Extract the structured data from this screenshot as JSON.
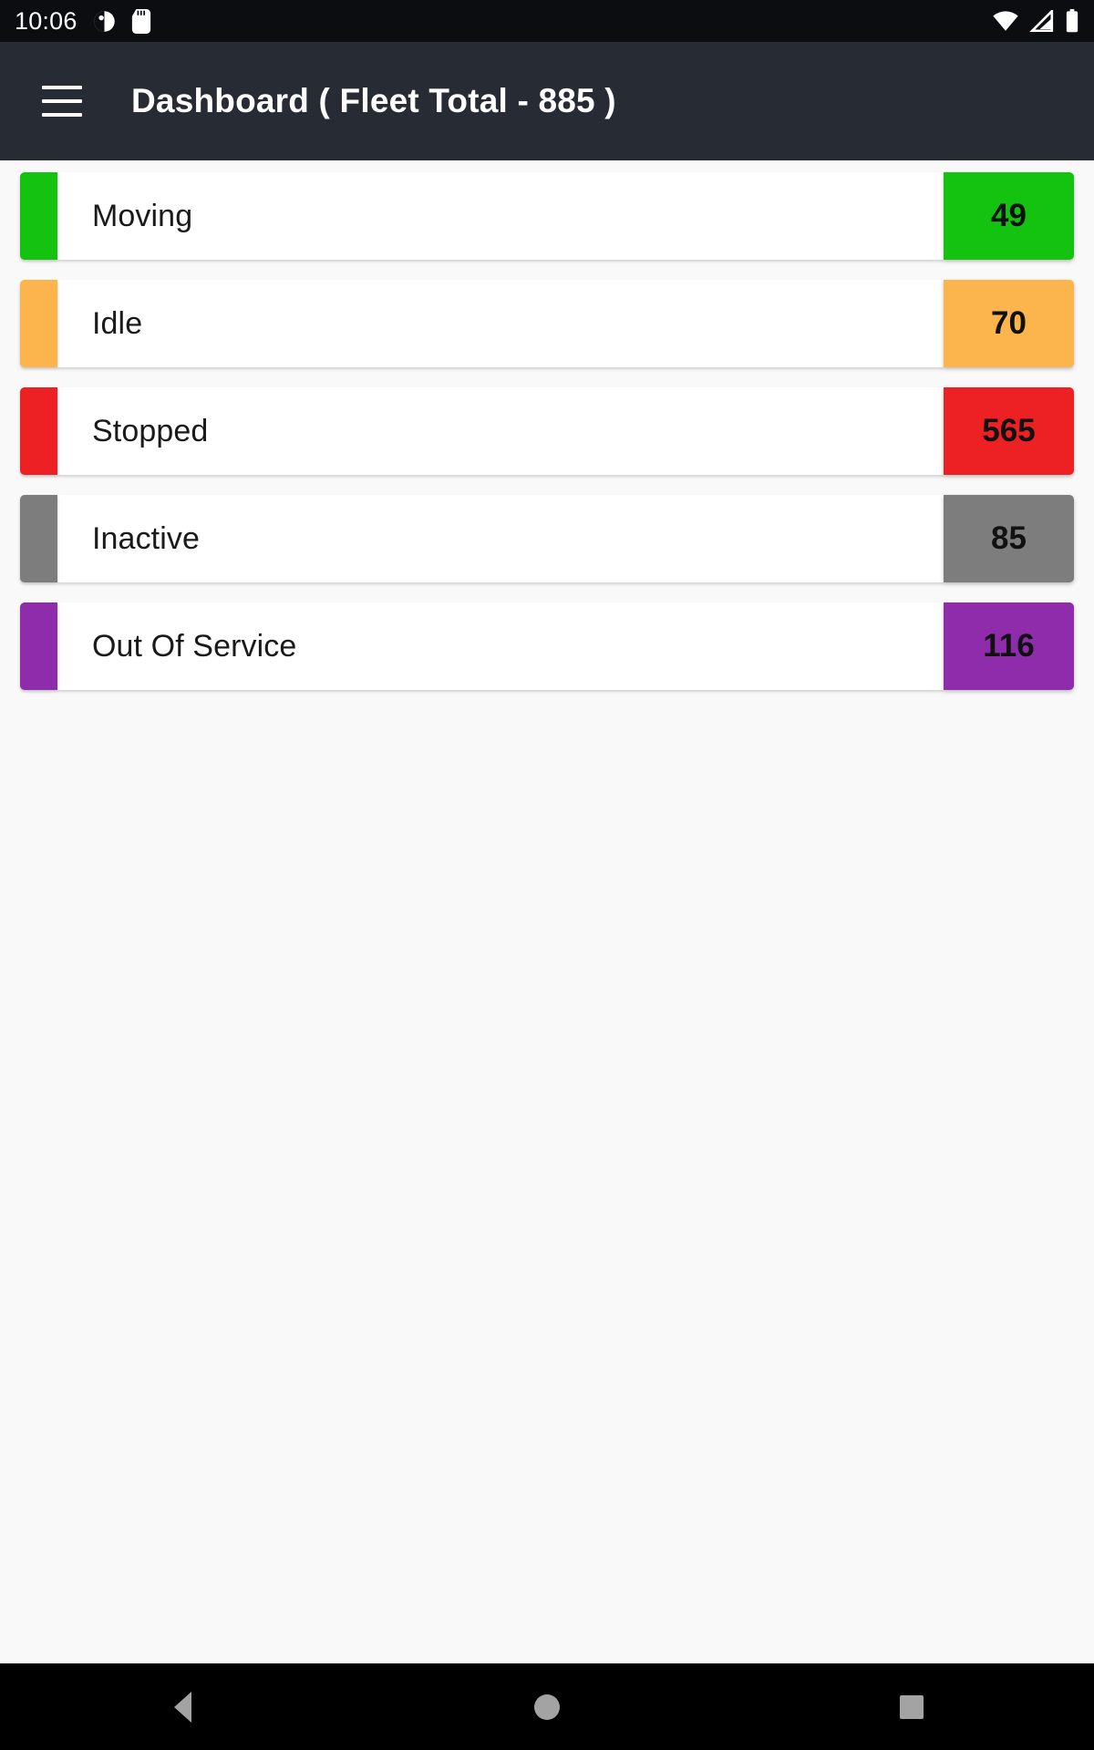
{
  "status_bar": {
    "time": "10:06",
    "left_icons": [
      "do-not-disturb-icon",
      "sd-card-icon"
    ],
    "right_icons": [
      "wifi-icon",
      "cellular-signal-icon",
      "battery-icon"
    ],
    "background": "#0B0D10",
    "foreground": "#FFFFFF"
  },
  "app_bar": {
    "menu_icon": "hamburger-menu-icon",
    "title": "Dashboard ( Fleet Total - 885 )",
    "background": "#272B33",
    "foreground": "#FFFFFF"
  },
  "fleet": {
    "total": 885,
    "rows": [
      {
        "label": "Moving",
        "value": "49",
        "color": "#13C310"
      },
      {
        "label": "Idle",
        "value": "70",
        "color": "#FCB44C"
      },
      {
        "label": "Stopped",
        "value": "565",
        "color": "#ED2024"
      },
      {
        "label": "Inactive",
        "value": "85",
        "color": "#7D7D7D"
      },
      {
        "label": "Out Of Service",
        "value": "116",
        "color": "#8E2CAC"
      }
    ]
  },
  "nav_bar": {
    "background": "#000000",
    "icon_color": "#A3A3A3",
    "buttons": [
      {
        "name": "back-button",
        "icon": "triangle-back-icon"
      },
      {
        "name": "home-button",
        "icon": "circle-home-icon"
      },
      {
        "name": "recents-button",
        "icon": "square-recents-icon"
      }
    ]
  }
}
